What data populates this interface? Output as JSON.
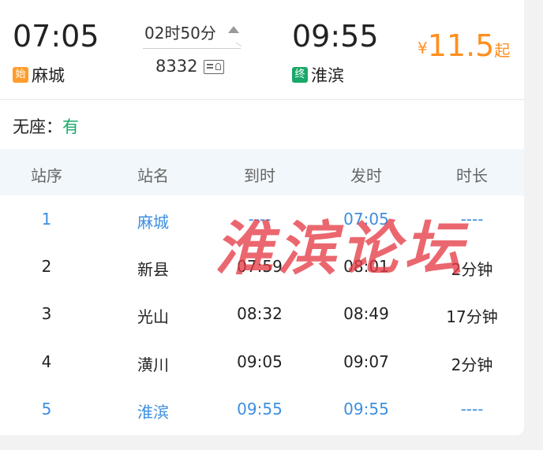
{
  "depart": {
    "time": "07:05",
    "tag": "始",
    "station": "麻城",
    "tag_color": "#ff8f1f"
  },
  "arrive": {
    "time": "09:55",
    "tag": "终",
    "station": "淮滨",
    "tag_color": "#19a869"
  },
  "duration": "02时50分",
  "train_no": "8332",
  "price": {
    "symbol": "¥",
    "value": "11.5",
    "suffix": "起"
  },
  "seat": {
    "label": "无座：",
    "value": "有"
  },
  "table": {
    "headers": [
      "站序",
      "站名",
      "到时",
      "发时",
      "时长"
    ],
    "rows": [
      [
        "1",
        "麻城",
        "----",
        "07:05",
        "----"
      ],
      [
        "2",
        "新县",
        "07:59",
        "08:01",
        "2分钟"
      ],
      [
        "3",
        "光山",
        "08:32",
        "08:49",
        "17分钟"
      ],
      [
        "4",
        "潢川",
        "09:05",
        "09:07",
        "2分钟"
      ],
      [
        "5",
        "淮滨",
        "09:55",
        "09:55",
        "----"
      ]
    ]
  },
  "watermark": "淮滨论坛",
  "colors": {
    "accent": "#ff8f1f",
    "highlight": "#3d8fe0",
    "green": "#19a869"
  }
}
